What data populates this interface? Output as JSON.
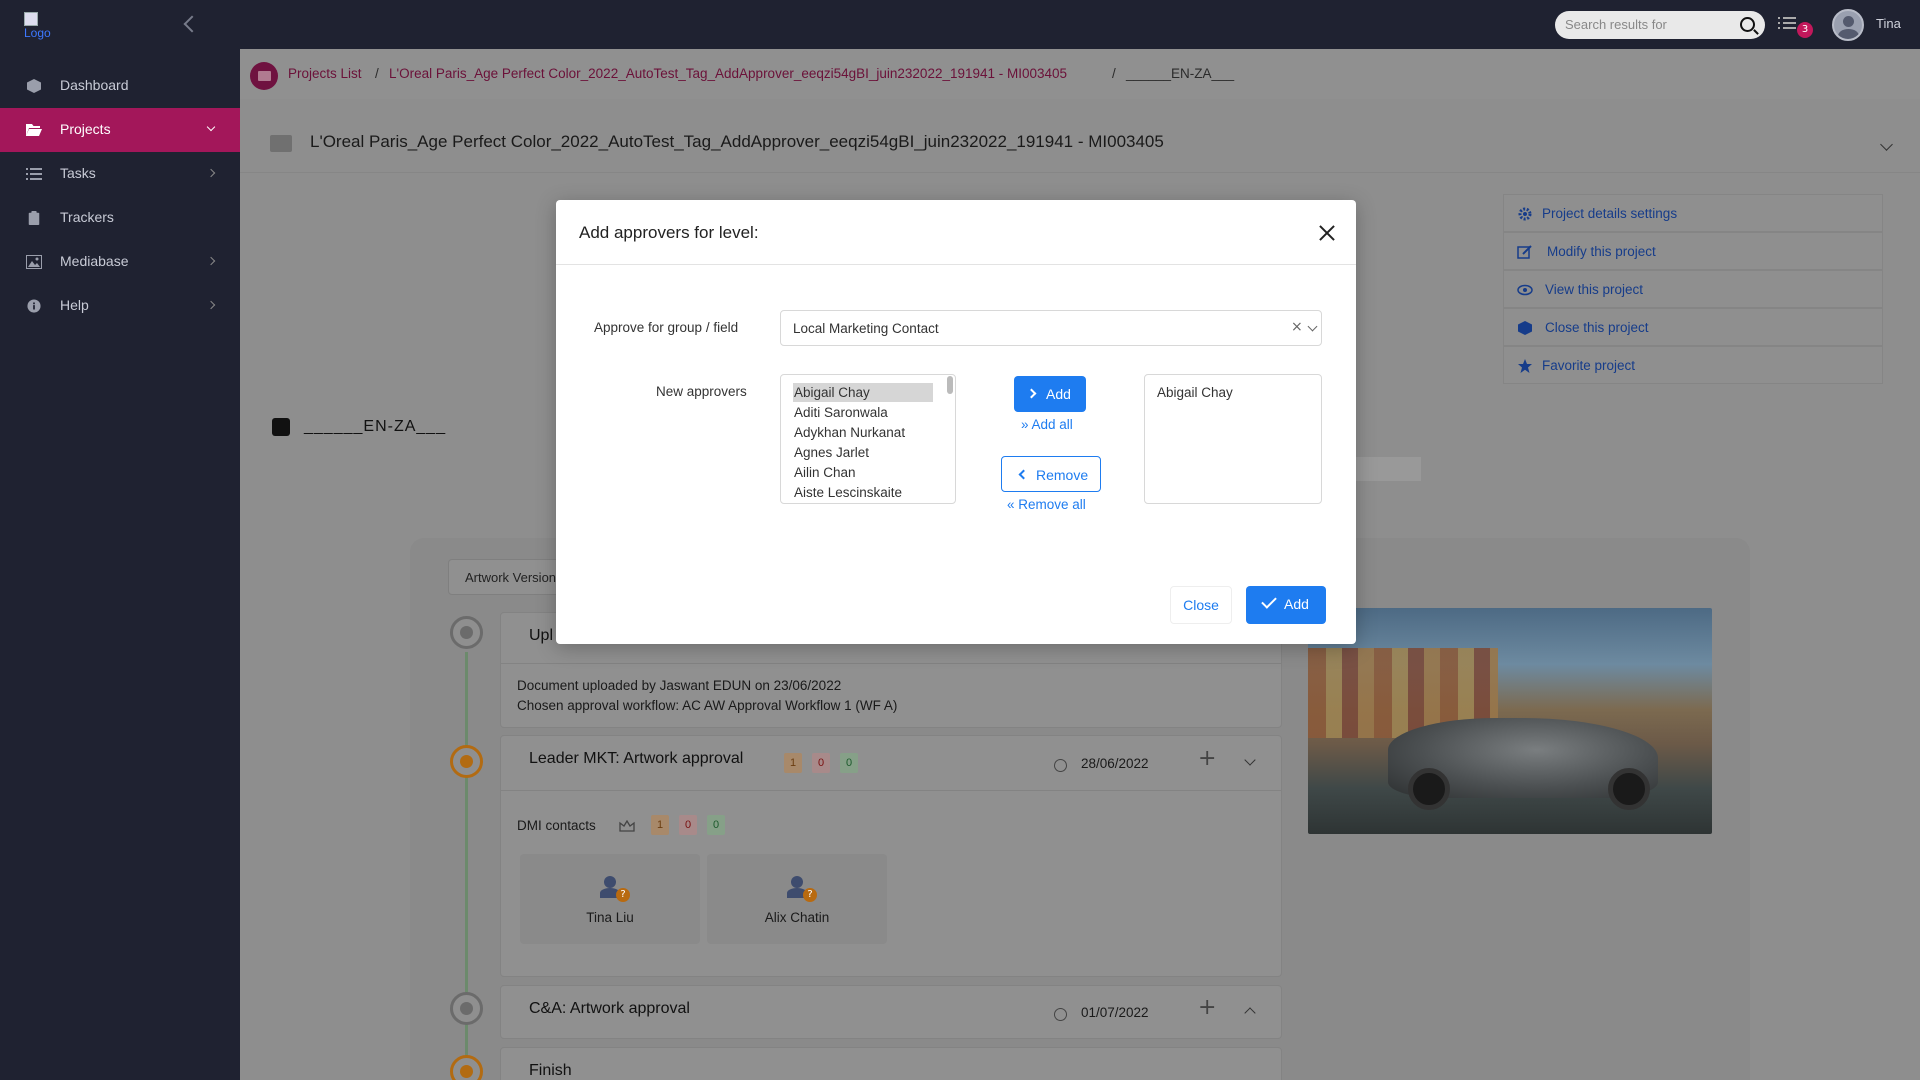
{
  "topbar": {
    "search_placeholder": "Search results for",
    "tasks_badge": "3",
    "user_name": "Tina"
  },
  "sidebar": {
    "logo_alt": "Logo",
    "items": [
      {
        "label": "Dashboard",
        "icon": "cube-icon",
        "has_chevron": false
      },
      {
        "label": "Projects",
        "icon": "folder-open-icon",
        "has_chevron": true,
        "active": true
      },
      {
        "label": "Tasks",
        "icon": "list-icon",
        "has_chevron": true
      },
      {
        "label": "Trackers",
        "icon": "clipboard-icon",
        "has_chevron": false
      },
      {
        "label": "Mediabase",
        "icon": "image-icon",
        "has_chevron": true
      },
      {
        "label": "Help",
        "icon": "info-icon",
        "has_chevron": true
      }
    ]
  },
  "breadcrumb": {
    "items": [
      "Projects List",
      "L'Oreal Paris_Age Perfect Color_2022_AutoTest_Tag_AddApprover_eeqzi54gBI_juin232022_191941 - MI003405",
      "______EN-ZA___"
    ],
    "separator": "/"
  },
  "project": {
    "title": "L'Oreal Paris_Age Perfect Color_2022_AutoTest_Tag_AddApprover_eeqzi54gBI_juin232022_191941 - MI003405",
    "lang_code": "______EN-ZA___"
  },
  "side_actions": [
    {
      "label": "Project details settings",
      "icon": "gear-icon"
    },
    {
      "label": "Modify this project",
      "icon": "edit-icon"
    },
    {
      "label": "View this project",
      "icon": "eye-icon"
    },
    {
      "label": "Close this project",
      "icon": "box-icon"
    },
    {
      "label": "Favorite project",
      "icon": "star-icon"
    }
  ],
  "workflow": {
    "artwork_select": "Artwork Version",
    "upload": {
      "title": "Upl",
      "line1": "Document uploaded by Jaswant EDUN on 23/06/2022",
      "line2": "Chosen approval workflow: AC AW Approval Workflow 1 (WF A)"
    },
    "step1": {
      "title": "Leader MKT: Artwork approval",
      "counts": [
        "1",
        "0",
        "0"
      ],
      "date": "28/06/2022",
      "group_label": "DMI contacts",
      "group_counts": [
        "1",
        "0",
        "0"
      ],
      "contacts": [
        "Tina Liu",
        "Alix Chatin"
      ]
    },
    "step2": {
      "title": "C&A: Artwork approval",
      "date": "01/07/2022"
    },
    "step3": {
      "title": "Finish"
    }
  },
  "modal": {
    "title": "Add approvers for level:",
    "group_field_label": "Approve for group / field",
    "group_field_value": "Local Marketing Contact",
    "new_approvers_label": "New approvers",
    "available": [
      "Abigail Chay",
      "Aditi Saronwala",
      "Adykhan Nurkanat",
      "Agnes Jarlet",
      "Ailin Chan",
      "Aiste Lescinskaite"
    ],
    "selected_available": "Abigail Chay",
    "add_label": "Add",
    "add_all_label": "Add all",
    "remove_label": "Remove",
    "remove_all_label": "Remove all",
    "chosen": [
      "Abigail Chay"
    ],
    "close_label": "Close",
    "confirm_label": "Add"
  },
  "colors": {
    "sidebar_bg": "#1f2231",
    "active_nav": "#a3175a",
    "primary_blue": "#1e7cf0"
  }
}
